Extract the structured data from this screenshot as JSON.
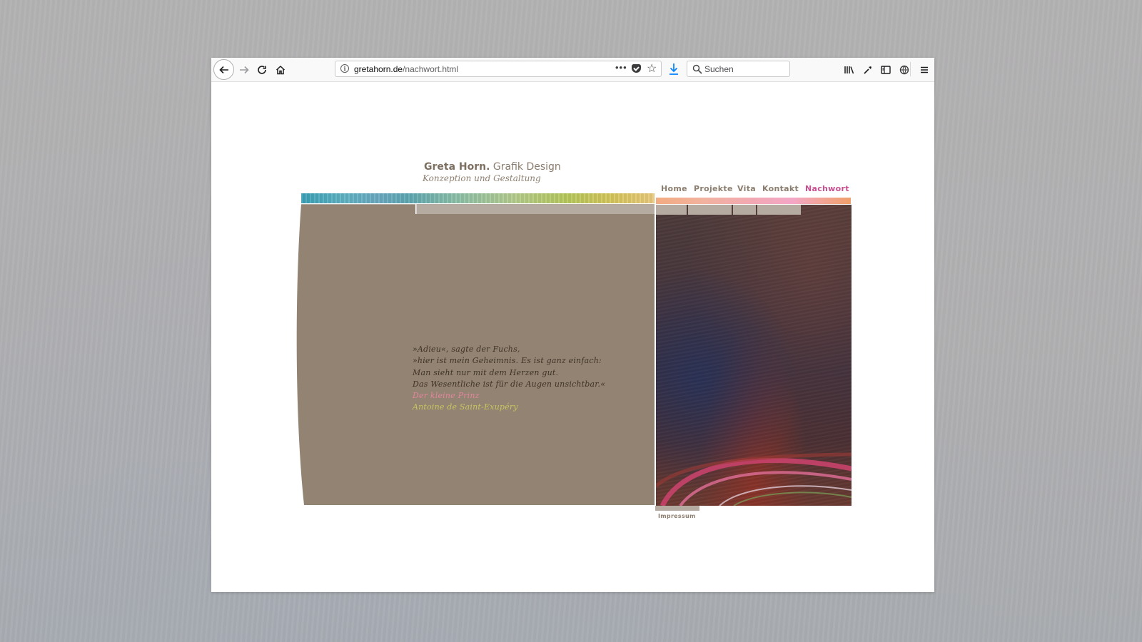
{
  "browser": {
    "url_domain": "gretahorn.de",
    "url_path": "/nachwort.html",
    "url_more": "•••",
    "search_placeholder": "Suchen",
    "icons": [
      "back-arrow-icon",
      "forward-arrow-icon",
      "reload-icon",
      "home-icon",
      "info-icon",
      "more-icon",
      "pocket-icon",
      "star-icon",
      "download-icon",
      "search-icon",
      "library-icon",
      "eyedropper-icon",
      "sidebar-icon",
      "globe-icon",
      "menu-icon"
    ]
  },
  "site": {
    "title_name": "Greta Horn.",
    "title_rest": " Grafik Design",
    "subtitle": "Konzeption und Gestaltung"
  },
  "nav": {
    "items": [
      {
        "label": "Home"
      },
      {
        "label": "Projekte"
      },
      {
        "label": "Vita"
      },
      {
        "label": "Kontakt"
      },
      {
        "label": "Nachwort",
        "active": true
      }
    ],
    "active_color": "#c74f8f",
    "color": "#8c7e6f"
  },
  "quote": {
    "lines": [
      "»Adieu«, sagte der Fuchs,",
      "»hier ist mein Geheimnis. Es ist ganz einfach:",
      "Man sieht nur mit dem Herzen gut.",
      "Das Wesentliche ist für die Augen unsichtbar.«"
    ],
    "title": "Der kleine Prinz",
    "author": "Antoine de Saint-Exupéry"
  },
  "footer": {
    "impressum": "Impressum"
  },
  "colors": {
    "panel": "#938372",
    "panel_tab": "#b5aba1",
    "title_accent_pink": "#e1859d",
    "author_accent_green": "#c7c560"
  }
}
